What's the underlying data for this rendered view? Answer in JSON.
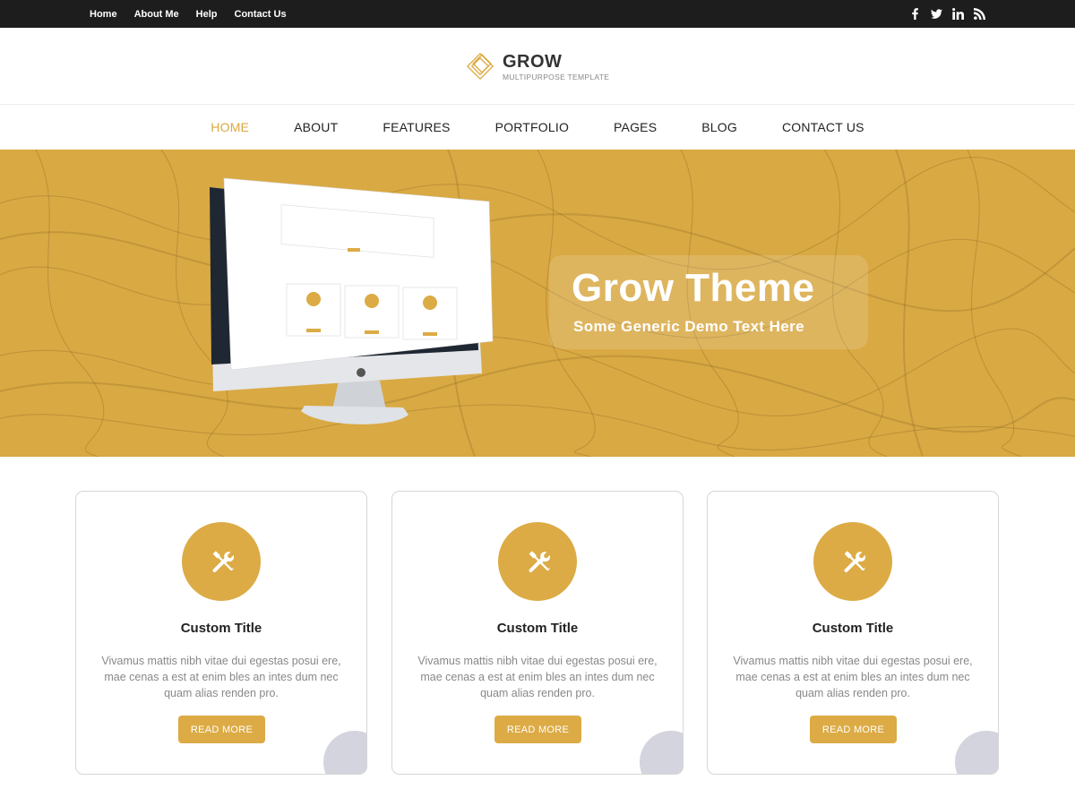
{
  "topbar": {
    "links": [
      "Home",
      "About Me",
      "Help",
      "Contact Us"
    ],
    "social_icons": [
      "facebook-icon",
      "twitter-icon",
      "linkedin-icon",
      "rss-icon"
    ]
  },
  "header": {
    "logo_name": "GROW",
    "logo_tagline": "MULTIPURPOSE TEMPLATE"
  },
  "nav": {
    "items": [
      "HOME",
      "ABOUT",
      "FEATURES",
      "PORTFOLIO",
      "PAGES",
      "BLOG",
      "CONTACT US"
    ],
    "active": "HOME"
  },
  "hero": {
    "title": "Grow Theme",
    "subtitle": "Some Generic Demo Text Here"
  },
  "cards": [
    {
      "icon": "tools-icon",
      "title": "Custom Title",
      "text": "Vivamus mattis nibh vitae dui egestas posui ere, mae cenas a est at enim bles an intes dum nec quam alias renden pro.",
      "button": "READ MORE"
    },
    {
      "icon": "tools-icon",
      "title": "Custom Title",
      "text": "Vivamus mattis nibh vitae dui egestas posui ere, mae cenas a est at enim bles an intes dum nec quam alias renden pro.",
      "button": "READ MORE"
    },
    {
      "icon": "tools-icon",
      "title": "Custom Title",
      "text": "Vivamus mattis nibh vitae dui egestas posui ere, mae cenas a est at enim bles an intes dum nec quam alias renden pro.",
      "button": "READ MORE"
    }
  ],
  "colors": {
    "accent": "#dba83e",
    "topbar": "#1d1d1d",
    "hero_bg": "#d9a943"
  }
}
